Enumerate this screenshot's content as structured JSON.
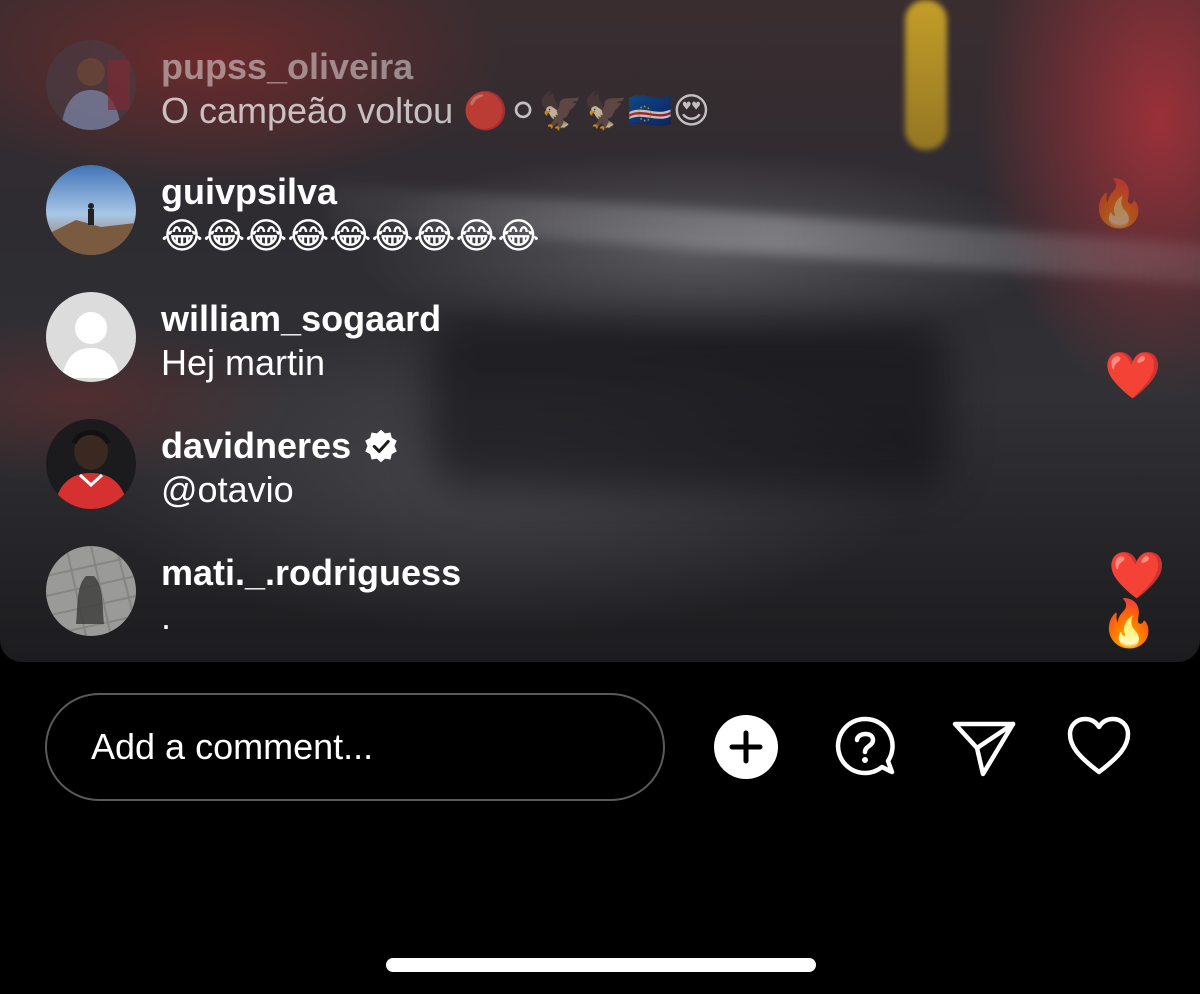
{
  "comments": [
    {
      "username": "pupss_oliveira",
      "text": "O campeão voltou 🔴⚪🦅🦅🇨🇻😍",
      "verified": false
    },
    {
      "username": "guivpsilva",
      "text": "😂😂😂😂😂😂😂😂😂",
      "verified": false
    },
    {
      "username": "william_sogaard",
      "text": "Hej martin",
      "verified": false
    },
    {
      "username": "davidneres",
      "text": "@otavio",
      "verified": true
    },
    {
      "username": "mati._.rodriguess",
      "text": ".",
      "verified": false
    }
  ],
  "reactions": {
    "fire_top": "🔥",
    "heart_mid": "❤️",
    "heart_low": "❤️",
    "fire_low": "🔥"
  },
  "composer": {
    "placeholder": "Add a comment..."
  },
  "icons": {
    "add": "plus-circle-icon",
    "question": "question-bubble-icon",
    "share": "paper-plane-icon",
    "like": "heart-outline-icon"
  },
  "colors": {
    "text": "#ffffff",
    "background": "#000000",
    "input_border": "#5a5a5a"
  }
}
